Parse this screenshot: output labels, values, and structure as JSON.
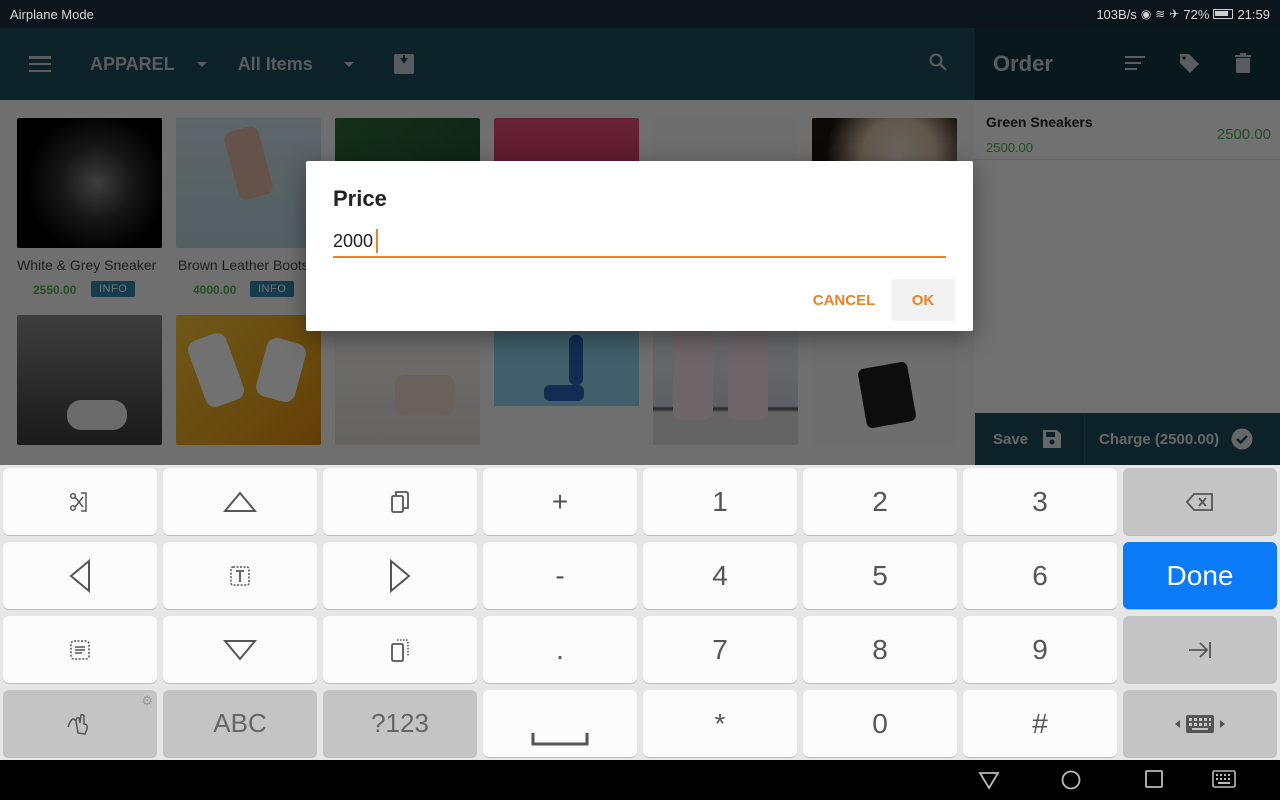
{
  "status_bar": {
    "left_text": "Airplane Mode",
    "net_speed": "103B/s",
    "battery": "72%",
    "time": "21:59",
    "icons": [
      "eye-icon",
      "wifi-icon",
      "airplane-icon",
      "battery-icon"
    ]
  },
  "top_bar": {
    "category": "APPAREL",
    "filter": "All Items",
    "icons": [
      "menu-icon",
      "import-icon",
      "search-icon"
    ]
  },
  "order_bar": {
    "title": "Order",
    "icons": [
      "sort-icon",
      "tag-icon",
      "trash-icon"
    ]
  },
  "products": [
    {
      "name": "White & Grey Sneaker",
      "price": "2550.00",
      "info": "INFO"
    },
    {
      "name": "Brown Leather Boots",
      "price": "4000.00",
      "info": "INFO"
    }
  ],
  "order": {
    "lines": [
      {
        "name": "Green Sneakers",
        "unit_price": "2500.00",
        "total": "2500.00"
      }
    ],
    "save_label": "Save",
    "charge_label": "Charge (2500.00)"
  },
  "dialog": {
    "title": "Price",
    "value": "2000",
    "cancel_label": "CANCEL",
    "ok_label": "OK"
  },
  "keyboard": {
    "rows": [
      [
        "cut-icon",
        "up-arrow-icon",
        "copy-icon",
        "+",
        "1",
        "2",
        "3",
        "backspace-icon"
      ],
      [
        "left-arrow-icon",
        "select-text-icon",
        "right-arrow-icon",
        "-",
        "4",
        "5",
        "6",
        "Done"
      ],
      [
        "select-all-icon",
        "down-arrow-icon",
        "paste-icon",
        ".",
        "7",
        "8",
        "9",
        "tab-icon"
      ],
      [
        "handwriting-icon",
        "ABC",
        "?123",
        "space-icon",
        "*",
        "0",
        "#",
        "keyboard-move-icon"
      ]
    ],
    "labels": {
      "plus": "+",
      "minus": "-",
      "dot": ".",
      "star": "*",
      "hash": "#",
      "d1": "1",
      "d2": "2",
      "d3": "3",
      "d4": "4",
      "d5": "5",
      "d6": "6",
      "d7": "7",
      "d8": "8",
      "d9": "9",
      "d0": "0",
      "done": "Done",
      "abc": "ABC",
      "sym": "?123"
    }
  },
  "nav_bar": {
    "icons": [
      "back-icon",
      "home-icon",
      "recents-icon",
      "keyboard-icon"
    ]
  },
  "colors": {
    "accent_orange": "#e9822a",
    "done_blue": "#0a7af7",
    "price_green": "#4caf50",
    "header_teal": "#1e4a5b"
  }
}
